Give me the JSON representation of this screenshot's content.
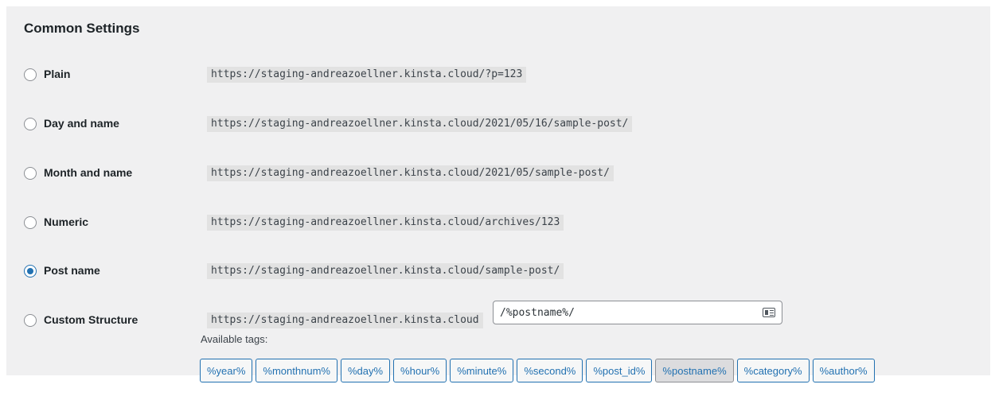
{
  "section": {
    "title": "Common Settings"
  },
  "options": [
    {
      "label": "Plain",
      "example": "https://staging-andreazoellner.kinsta.cloud/?p=123",
      "checked": false
    },
    {
      "label": "Day and name",
      "example": "https://staging-andreazoellner.kinsta.cloud/2021/05/16/sample-post/",
      "checked": false
    },
    {
      "label": "Month and name",
      "example": "https://staging-andreazoellner.kinsta.cloud/2021/05/sample-post/",
      "checked": false
    },
    {
      "label": "Numeric",
      "example": "https://staging-andreazoellner.kinsta.cloud/archives/123",
      "checked": false
    },
    {
      "label": "Post name",
      "example": "https://staging-andreazoellner.kinsta.cloud/sample-post/",
      "checked": true
    },
    {
      "label": "Custom Structure",
      "example": "https://staging-andreazoellner.kinsta.cloud",
      "checked": false
    }
  ],
  "custom": {
    "value": "/%postname%/",
    "icon": "field-card-icon",
    "available_tags_label": "Available tags:",
    "tags": [
      {
        "label": "%year%",
        "active": false
      },
      {
        "label": "%monthnum%",
        "active": false
      },
      {
        "label": "%day%",
        "active": false
      },
      {
        "label": "%hour%",
        "active": false
      },
      {
        "label": "%minute%",
        "active": false
      },
      {
        "label": "%second%",
        "active": false
      },
      {
        "label": "%post_id%",
        "active": false
      },
      {
        "label": "%postname%",
        "active": true
      },
      {
        "label": "%category%",
        "active": false
      },
      {
        "label": "%author%",
        "active": false
      }
    ]
  },
  "colors": {
    "accent": "#2271b1",
    "panel_bg": "#f0f0f1",
    "code_bg": "#e2e2e2"
  }
}
